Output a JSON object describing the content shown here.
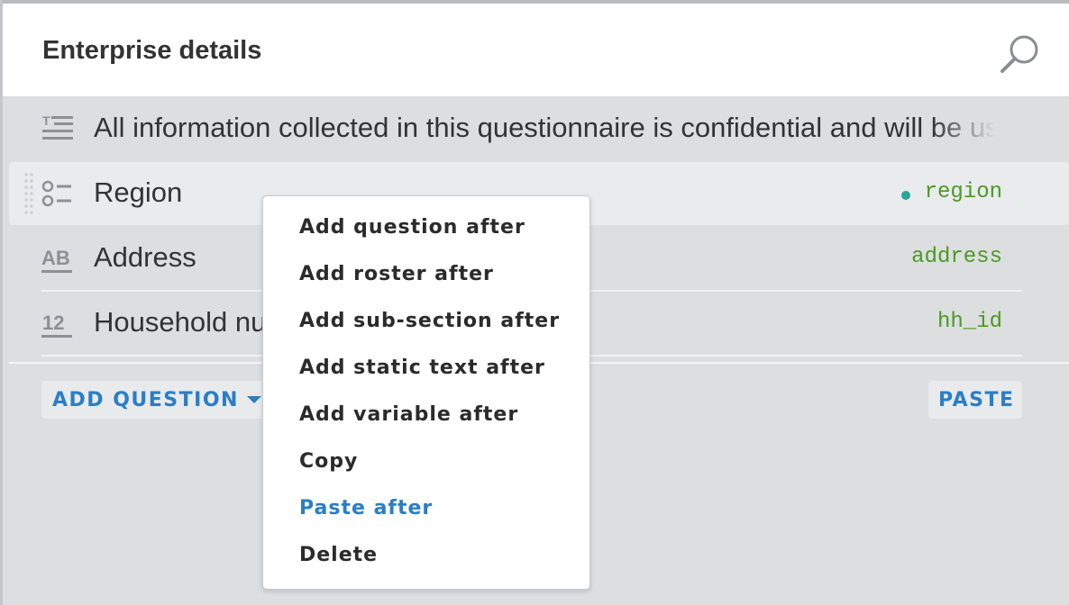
{
  "header": {
    "title": "Enterprise details"
  },
  "items": [
    {
      "type": "static-text",
      "icon": "static-text-icon",
      "label": "All information collected in this questionnaire is confidential and will be used",
      "variable": ""
    },
    {
      "type": "single-select",
      "icon": "single-select-icon",
      "label": "Region",
      "variable": "region",
      "selected": true
    },
    {
      "type": "text",
      "icon": "text-question-icon",
      "icon_text": "AB",
      "label": "Address",
      "variable": "address"
    },
    {
      "type": "numeric",
      "icon": "numeric-question-icon",
      "icon_text": "12",
      "label": "Household number",
      "variable": "hh_id"
    }
  ],
  "footer": {
    "add_question_label": "ADD QUESTION",
    "paste_label": "PASTE"
  },
  "context_menu": {
    "items": [
      "Add question after",
      "Add roster after",
      "Add sub-section after",
      "Add static text after",
      "Add variable after",
      "Copy",
      "Paste after",
      "Delete"
    ]
  },
  "colors": {
    "accent_blue": "#2a7ec6",
    "variable_green": "#4a9a22",
    "status_dot": "#27a59a"
  }
}
